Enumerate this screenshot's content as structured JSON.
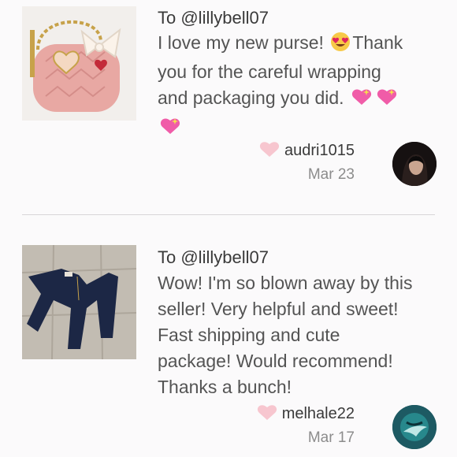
{
  "reviews": [
    {
      "to": "To @lillybell07",
      "text_line1": "I love my new purse! ",
      "text_line1b": "Thank",
      "text_line2": "you for the careful wrapping",
      "text_line3": "and packaging you did. ",
      "username": "audri1015",
      "date": "Mar 23",
      "product_icon": "pink-purse-image"
    },
    {
      "to": "To @lillybell07",
      "text": [
        "Wow! I'm so blown away by this",
        "seller! Very helpful and sweet!",
        "Fast shipping and cute",
        "package! Would recommend!",
        "Thanks a bunch!"
      ],
      "username": "melhale22",
      "date": "Mar 17",
      "product_icon": "jeans-image"
    }
  ],
  "colors": {
    "heart": "#f7c6cf",
    "text": "#545454",
    "date": "#8c8c8c"
  }
}
